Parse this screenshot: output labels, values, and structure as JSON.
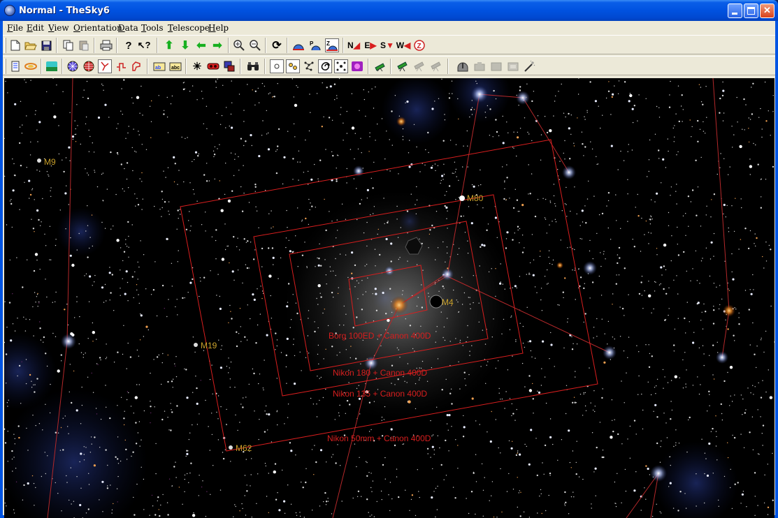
{
  "window": {
    "title": "Normal - TheSky6"
  },
  "menu": [
    {
      "label": "File",
      "key": "F",
      "rest": "ile"
    },
    {
      "label": "Edit",
      "key": "E",
      "rest": "dit"
    },
    {
      "label": "View",
      "key": "V",
      "rest": "iew"
    },
    {
      "label": "Orientation",
      "key": "O",
      "rest": "rientation"
    },
    {
      "label": "Data",
      "key": "D",
      "rest": "ata"
    },
    {
      "label": "Tools",
      "key": "T",
      "rest": "ools"
    },
    {
      "label": "Telescope",
      "key": "T",
      "rest": "elescope"
    },
    {
      "label": "Help",
      "key": "H",
      "rest": "elp"
    }
  ],
  "toolbar1": {
    "orientation_buttons": {
      "north": "N",
      "east": "E",
      "south": "S",
      "west": "W",
      "zenith": "Z"
    }
  },
  "sky": {
    "object_labels": {
      "m9": "M9",
      "m80": "M80",
      "m4": "M4",
      "m19": "M19",
      "m62": "M62"
    },
    "fov_labels": {
      "borg": "Borg 100ED + Canon 400D",
      "nikon180": "Nikon 180 + Canon 400D",
      "nikon135": "Nikon 135 + Canon 400D",
      "nikon50": "Nikon 50mm + Canon 400D"
    }
  },
  "colors": {
    "fov_frame": "#d81e1e",
    "constellation_line": "#b4282a",
    "object_label": "#c8a02a",
    "titlebar": "#0052e0"
  }
}
